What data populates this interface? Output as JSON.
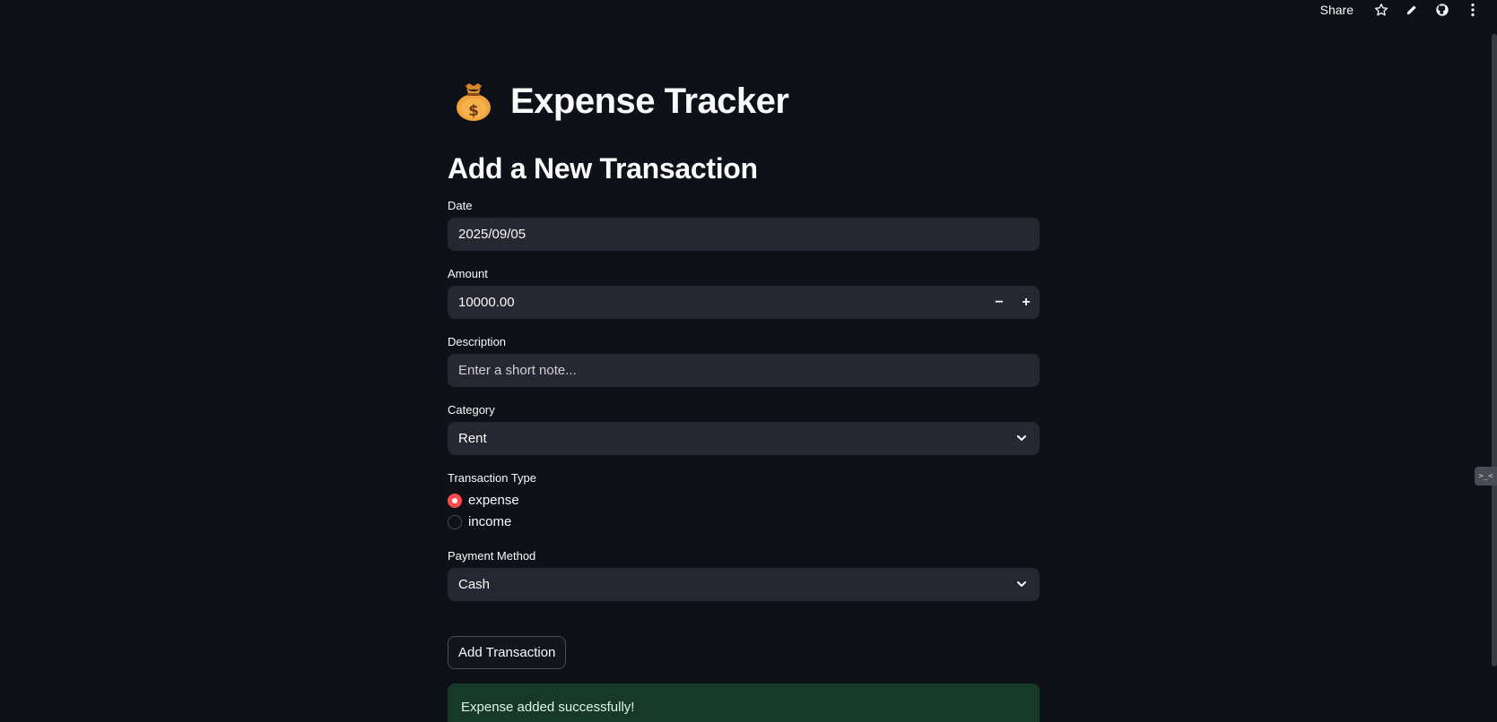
{
  "toolbar": {
    "share_label": "Share",
    "icons": [
      "star-icon",
      "pencil-icon",
      "github-icon",
      "kebab-menu-icon"
    ]
  },
  "header": {
    "emoji_icon": "money-bag-icon",
    "title": "Expense Tracker",
    "subtitle": "Add a New Transaction"
  },
  "form": {
    "date": {
      "label": "Date",
      "value": "2025/09/05"
    },
    "amount": {
      "label": "Amount",
      "value": "10000.00",
      "minus": "−",
      "plus": "+"
    },
    "description": {
      "label": "Description",
      "value": "",
      "placeholder": "Enter a short note..."
    },
    "category": {
      "label": "Category",
      "value": "Rent"
    },
    "transaction_type": {
      "label": "Transaction Type",
      "options": [
        "expense",
        "income"
      ],
      "selected": "expense"
    },
    "payment_method": {
      "label": "Payment Method",
      "value": "Cash"
    },
    "submit_label": "Add Transaction"
  },
  "alert": {
    "message": "Expense added successfully!"
  },
  "colors": {
    "background": "#0e1117",
    "field": "#262730",
    "accent": "#ff4b4b",
    "success_bg": "#173928"
  }
}
